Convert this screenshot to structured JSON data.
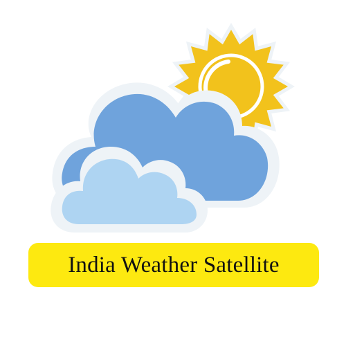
{
  "banner": {
    "title": "India Weather Satellite"
  },
  "logo": {
    "icon": "partly-cloudy-icon",
    "colors": {
      "sun": "#f2c21c",
      "sun_ring": "#ffffff",
      "cloud_back": "#6fa3dc",
      "cloud_front": "#aed4f2",
      "outline": "#eef3f7",
      "banner_bg": "#fde910",
      "banner_text": "#111111"
    }
  }
}
